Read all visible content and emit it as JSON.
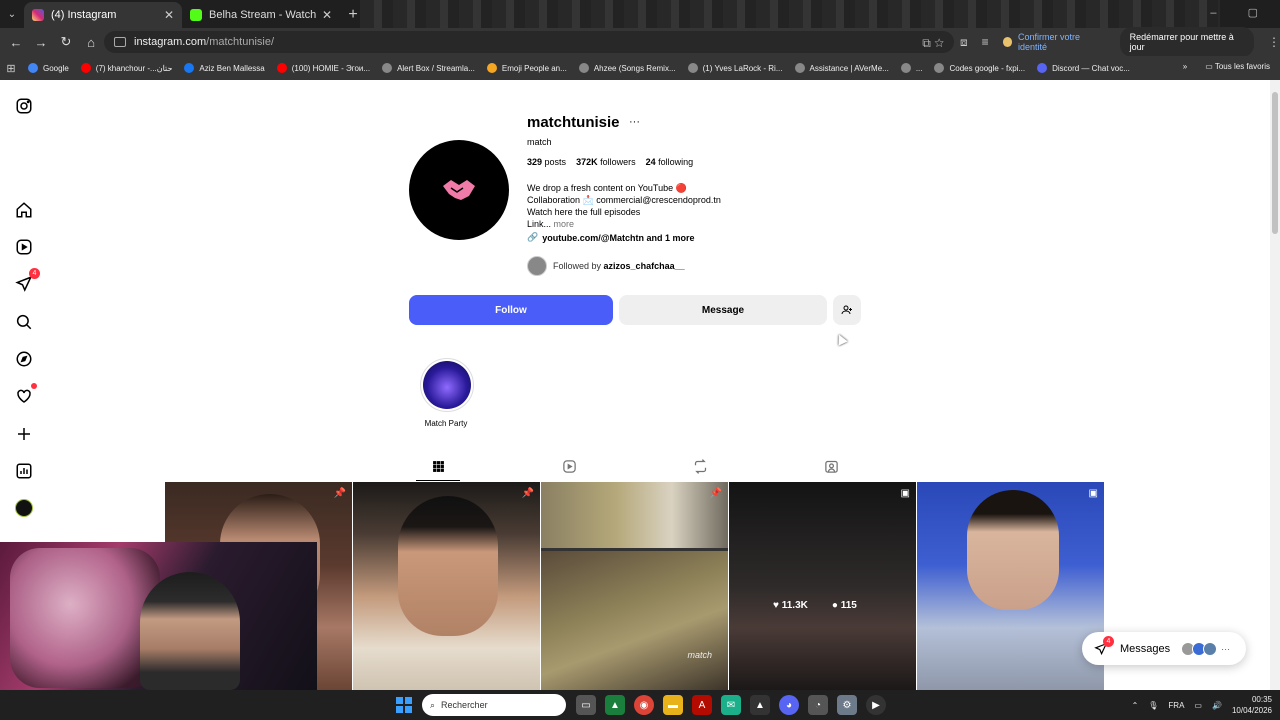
{
  "browser": {
    "tabs": [
      {
        "title": "(4) Instagram",
        "active": true,
        "favicon_color": "#d6249f"
      },
      {
        "title": "Belha Stream - Watch Live on K",
        "active": false,
        "favicon_color": "#53fc18"
      }
    ],
    "url_host": "instagram.com",
    "url_path": "/matchtunisie/",
    "identity_label": "Confirmer votre identité",
    "restart_label": "Redémarrer pour mettre à jour",
    "bookmarks": [
      {
        "label": "Google",
        "color": "#4285f4"
      },
      {
        "label": "(7) khanchour -...حتان",
        "color": "#ff0000"
      },
      {
        "label": "Aziz Ben Mallessa",
        "color": "#1877f2"
      },
      {
        "label": "(100) HOMIE - Эгои...",
        "color": "#ff0000"
      },
      {
        "label": "Alert Box / Streamla...",
        "color": "#888888"
      },
      {
        "label": "Emoji People an...",
        "color": "#f5a623"
      },
      {
        "label": "Ahzee (Songs Remix...",
        "color": "#888888"
      },
      {
        "label": "(1) Yves LaRock - Ri...",
        "color": "#888888"
      },
      {
        "label": "Assistance | AVerMe...",
        "color": "#888888"
      },
      {
        "label": "...",
        "color": "#888888"
      },
      {
        "label": "Codes google - fxpi...",
        "color": "#888888"
      },
      {
        "label": "Discord — Chat voc...",
        "color": "#5865f2"
      }
    ],
    "all_bookmarks_label": "Tous les favoris"
  },
  "sidebar": {
    "notifications_badge": "4"
  },
  "profile": {
    "username": "matchtunisie",
    "full_name": "match",
    "posts_count": "329",
    "posts_label": "posts",
    "followers_count": "372K",
    "followers_label": "followers",
    "following_count": "24",
    "following_label": "following",
    "bio_line1": "We drop a fresh content on YouTube 🔴",
    "bio_line2": "Collaboration 📩 commercial@crescendoprod.tn",
    "bio_line3": "Watch here the full episodes",
    "bio_line4": "Link...",
    "bio_more": "more",
    "link_text": "youtube.com/@Matchtn and 1 more",
    "followed_by_prefix": "Followed by",
    "followed_by_user": "azizos_chafchaa__",
    "follow_button": "Follow",
    "message_button": "Message",
    "highlight_label": "Match Party",
    "accent_color": "#4a5df9"
  },
  "posts": [
    {
      "pinned": true
    },
    {
      "pinned": true
    },
    {
      "pinned": true,
      "watermark": "match"
    },
    {
      "likes": "11.3K",
      "comments": "115"
    },
    {
      "reel": true
    }
  ],
  "messages_pill": {
    "label": "Messages",
    "badge": "4"
  },
  "taskbar": {
    "search_placeholder": "Rechercher",
    "language": "FRA",
    "time": "00:35",
    "date": "10/04/2026"
  }
}
